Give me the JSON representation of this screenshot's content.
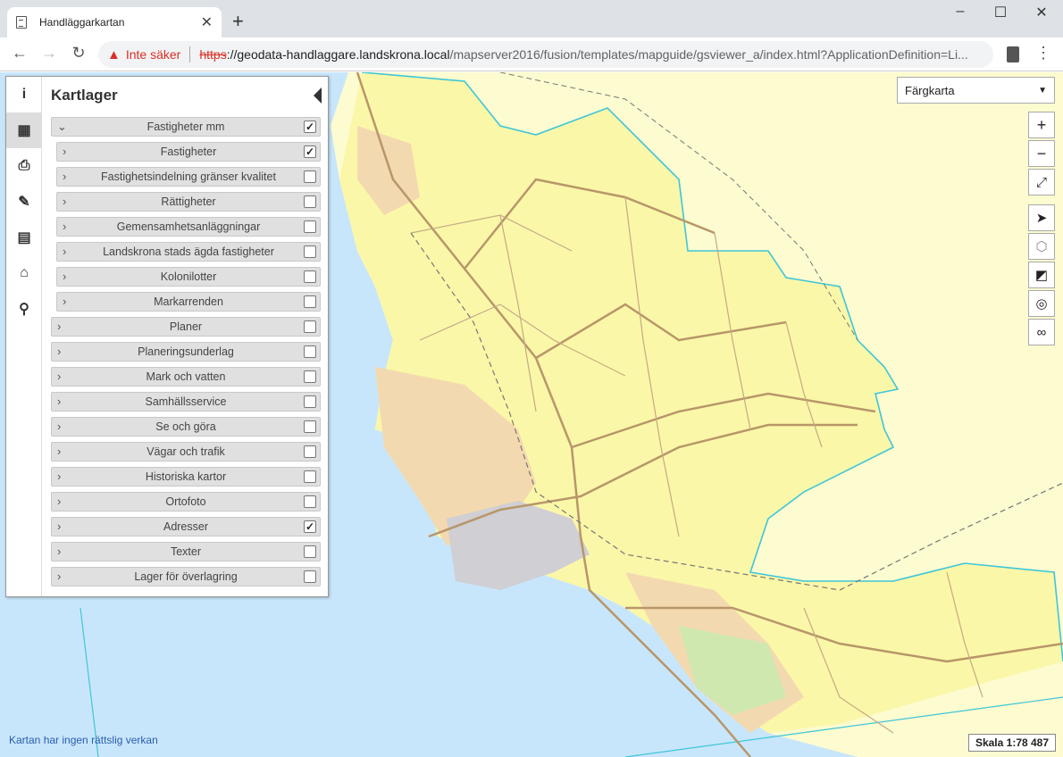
{
  "browser": {
    "tab_title": "Handläggarkartan",
    "new_tab_label": "+",
    "window_controls": {
      "minimize": "–",
      "maximize": "☐",
      "close": "✕"
    },
    "address": {
      "security_label": "Inte säker",
      "scheme": "https",
      "host": "://geodata-handlaggare.landskrona.local",
      "path": "/mapserver2016/fusion/templates/mapguide/gsviewer_a/index.html?ApplicationDefinition=Li..."
    }
  },
  "panel": {
    "title": "Kartlager",
    "sidebar_icons": [
      "info-icon",
      "map-icon",
      "print-icon",
      "pencil-icon",
      "document-icon",
      "home-icon",
      "search-icon"
    ],
    "layers": [
      {
        "label": "Fastigheter mm",
        "checked": true,
        "expanded": true,
        "indent": 0
      },
      {
        "label": "Fastigheter",
        "checked": true,
        "expanded": false,
        "indent": 1
      },
      {
        "label": "Fastighetsindelning gränser kvalitet",
        "checked": false,
        "expanded": false,
        "indent": 1
      },
      {
        "label": "Rättigheter",
        "checked": false,
        "expanded": false,
        "indent": 1
      },
      {
        "label": "Gemensamhetsanläggningar",
        "checked": false,
        "expanded": false,
        "indent": 1
      },
      {
        "label": "Landskrona stads ägda fastigheter",
        "checked": false,
        "expanded": false,
        "indent": 1
      },
      {
        "label": "Kolonilotter",
        "checked": false,
        "expanded": false,
        "indent": 1
      },
      {
        "label": "Markarrenden",
        "checked": false,
        "expanded": false,
        "indent": 1
      },
      {
        "label": "Planer",
        "checked": false,
        "expanded": false,
        "indent": 0
      },
      {
        "label": "Planeringsunderlag",
        "checked": false,
        "expanded": false,
        "indent": 0
      },
      {
        "label": "Mark och vatten",
        "checked": false,
        "expanded": false,
        "indent": 0
      },
      {
        "label": "Samhällsservice",
        "checked": false,
        "expanded": false,
        "indent": 0
      },
      {
        "label": "Se och göra",
        "checked": false,
        "expanded": false,
        "indent": 0
      },
      {
        "label": "Vägar och trafik",
        "checked": false,
        "expanded": false,
        "indent": 0
      },
      {
        "label": "Historiska kartor",
        "checked": false,
        "expanded": false,
        "indent": 0
      },
      {
        "label": "Ortofoto",
        "checked": false,
        "expanded": false,
        "indent": 0
      },
      {
        "label": "Adresser",
        "checked": true,
        "expanded": false,
        "indent": 0
      },
      {
        "label": "Texter",
        "checked": false,
        "expanded": false,
        "indent": 0
      },
      {
        "label": "Lager för överlagring",
        "checked": false,
        "expanded": false,
        "indent": 0
      }
    ]
  },
  "basemap": {
    "selected": "Färgkarta"
  },
  "map_controls": {
    "zoom_in": "+",
    "zoom_out": "−",
    "icons": [
      "fullscreen-icon",
      "locate-icon",
      "polygon-icon",
      "measure-icon",
      "compass-icon",
      "link-icon"
    ]
  },
  "footer": {
    "disclaimer": "Kartan har ingen rättslig verkan",
    "scale": "Skala 1:78 487"
  },
  "colors": {
    "sea": "#c8e6fb",
    "land": "#fdfbd0",
    "municipality": "#fbf7a8",
    "boundary": "#3ec6d8",
    "road": "#b8966a",
    "urban": "#f3d9b0"
  }
}
